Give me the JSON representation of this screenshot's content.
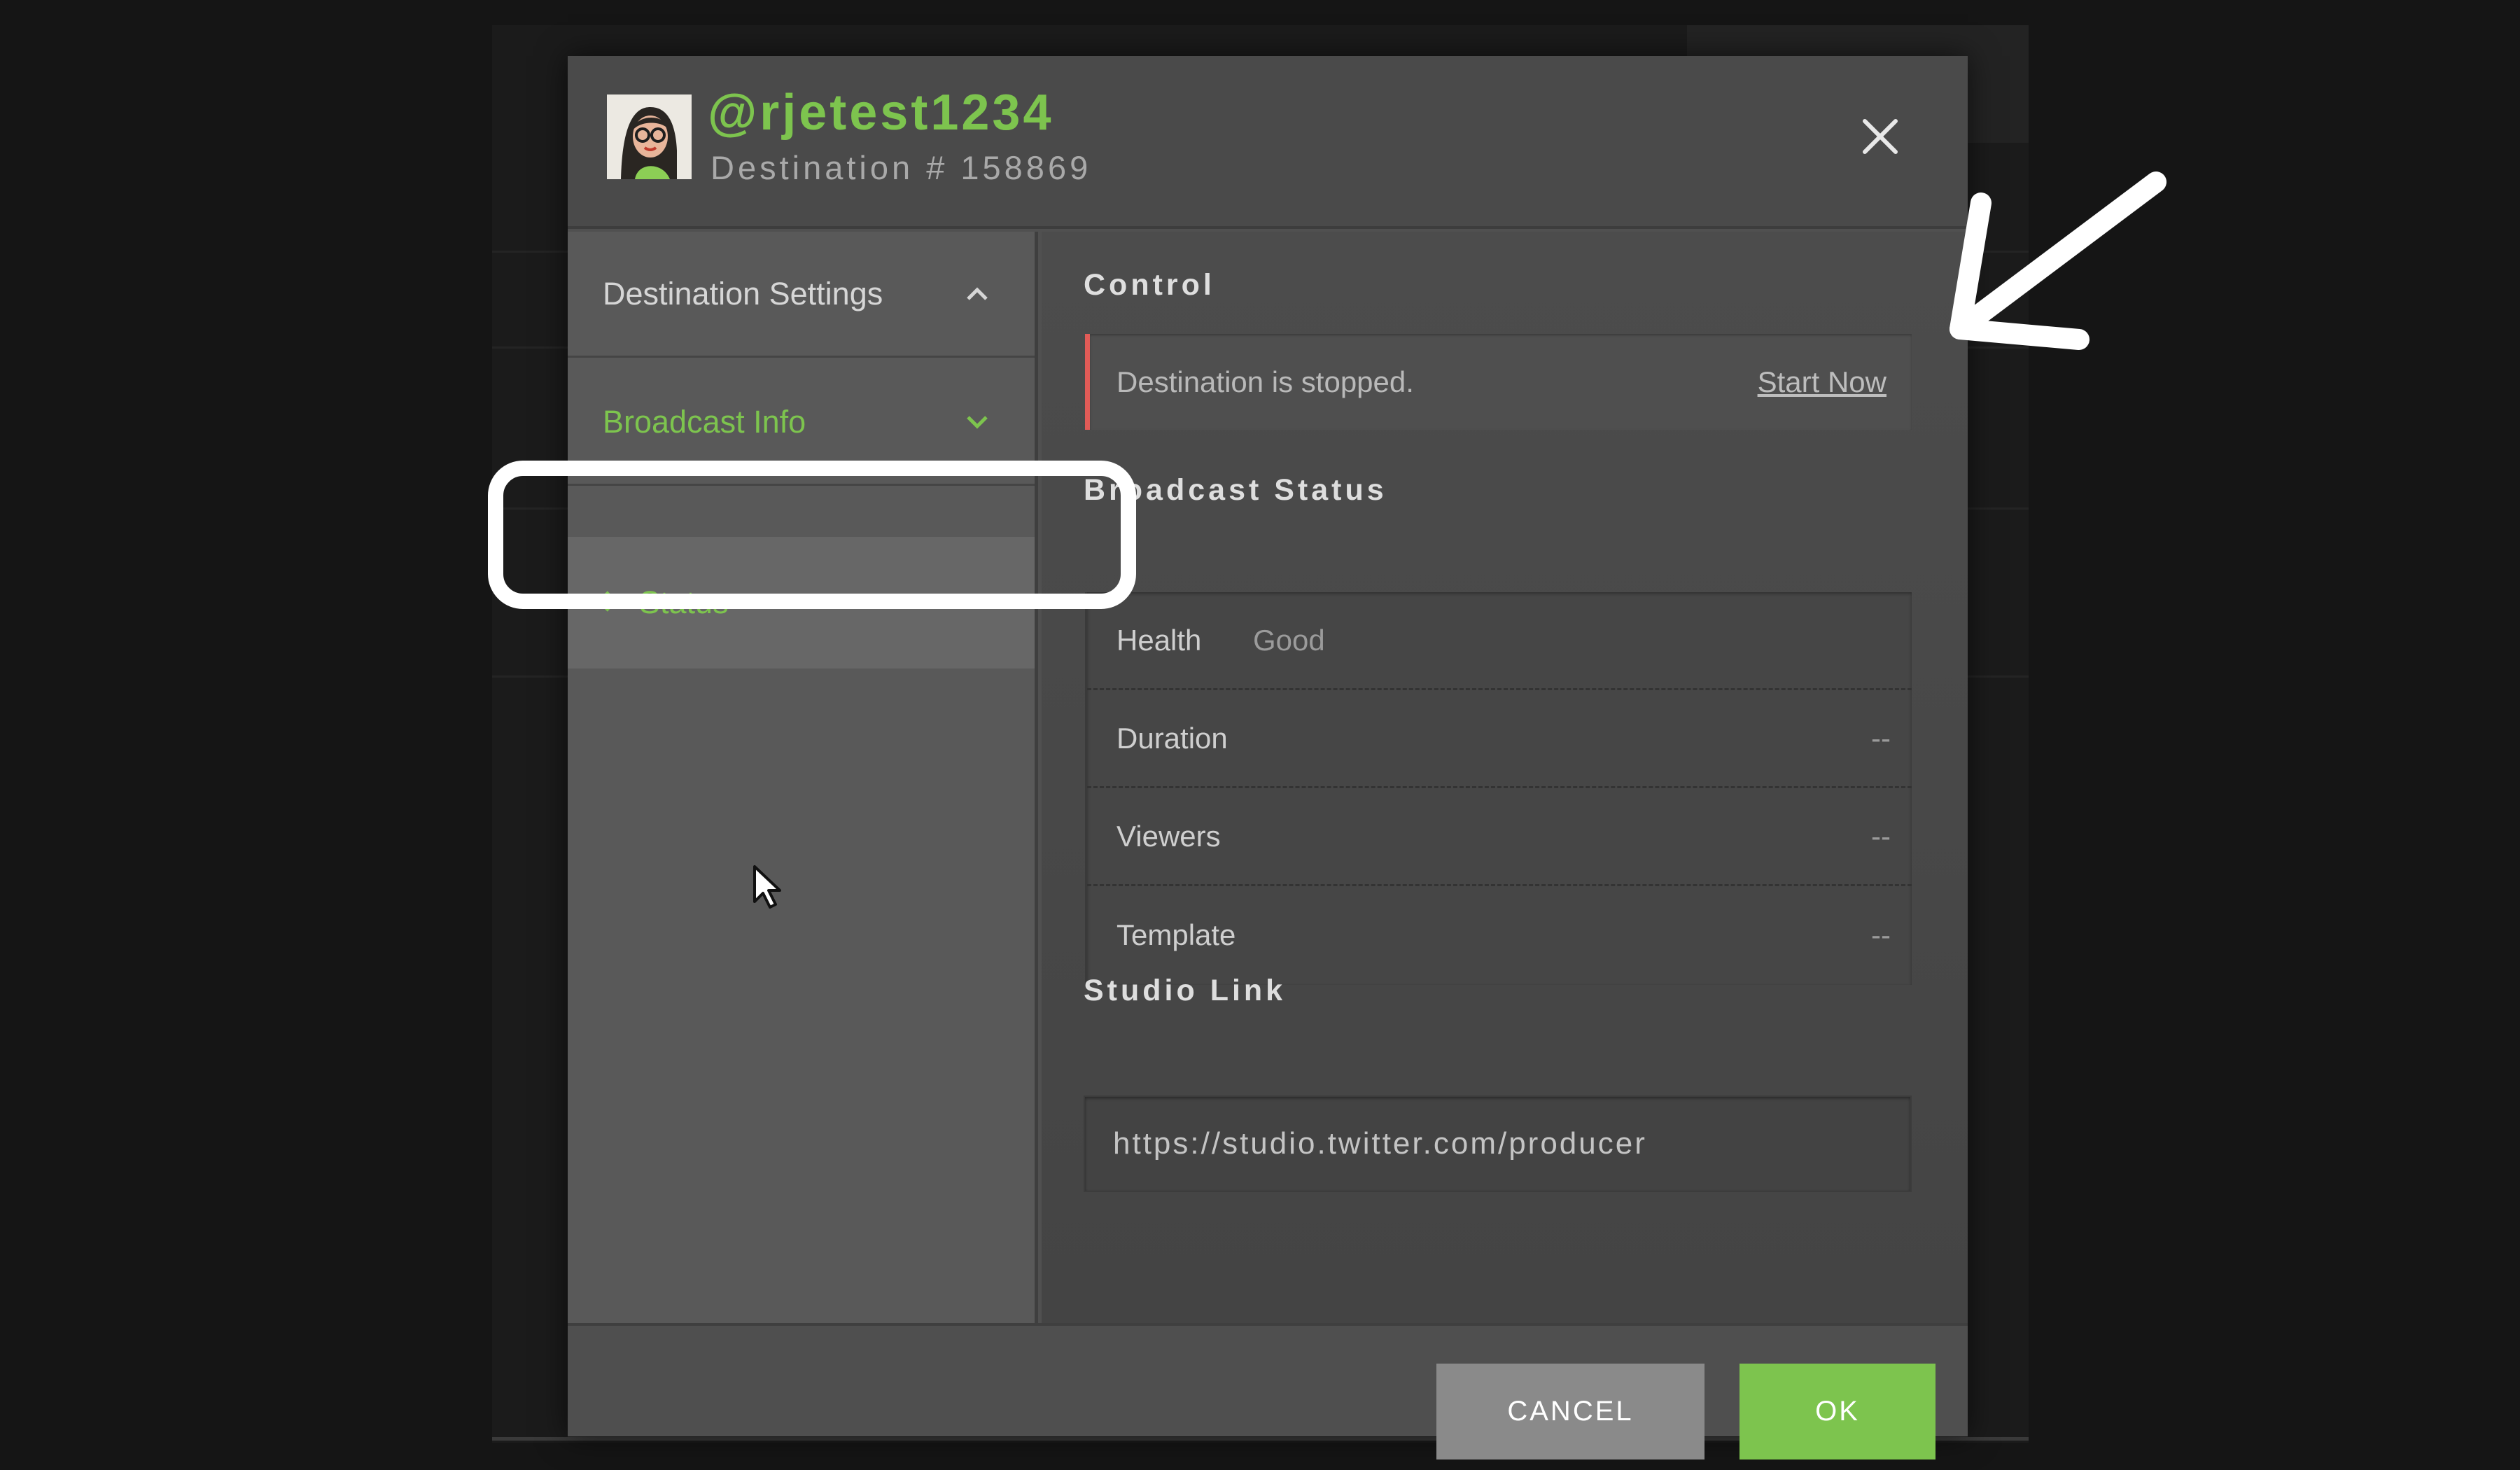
{
  "header": {
    "handle": "@rjetest1234",
    "destination": "Destination # 158869",
    "avatar_icon": "user-avatar",
    "close_icon": "close-icon"
  },
  "sidebar": {
    "items": [
      {
        "label": "Destination Settings",
        "state": "expanded"
      },
      {
        "label": "Broadcast Info",
        "state": "collapsed"
      }
    ],
    "subitem": {
      "label": "Status"
    }
  },
  "control": {
    "title": "Control",
    "message": "Destination is stopped.",
    "action": "Start Now"
  },
  "broadcast_status": {
    "title": "Broadcast Status",
    "rows": [
      {
        "label": "Health",
        "value": "Good"
      },
      {
        "label": "Duration",
        "value": "--"
      },
      {
        "label": "Viewers",
        "value": "--"
      },
      {
        "label": "Template",
        "value": "--"
      }
    ]
  },
  "studio_link": {
    "title": "Studio Link",
    "value": "https://studio.twitter.com/producer"
  },
  "footer": {
    "cancel_label": "CANCEL",
    "ok_label": "OK"
  },
  "colors": {
    "accent": "#7dc44e",
    "stopped": "#e25b57",
    "annotation": "#ffffff"
  }
}
